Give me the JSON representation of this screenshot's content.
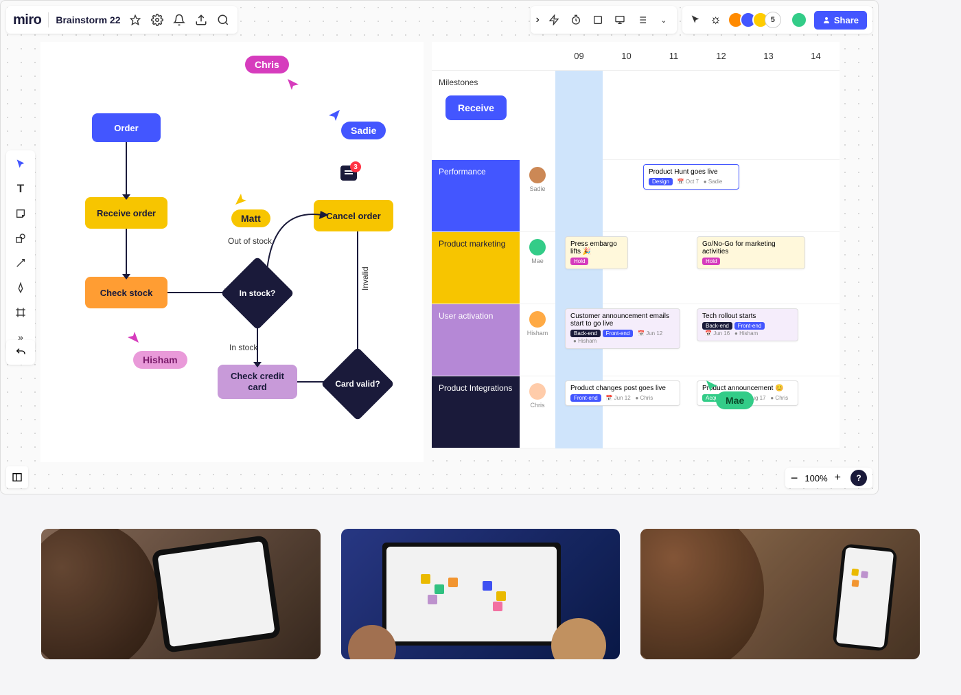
{
  "header": {
    "logo": "miro",
    "board_title": "Brainstorm 22",
    "avatar_overflow": "5",
    "share_label": "Share"
  },
  "flowchart": {
    "nodes": {
      "order": "Order",
      "receive": "Receive order",
      "check_stock": "Check stock",
      "in_stock_q": "In stock?",
      "cancel": "Cancel order",
      "check_cc": "Check credit card",
      "card_valid_q": "Card valid?"
    },
    "labels": {
      "out_of_stock": "Out of stock",
      "in_stock": "In stock",
      "invalid": "Invalid"
    },
    "cursors": {
      "chris": "Chris",
      "sadie": "Sadie",
      "matt": "Matt",
      "hisham": "Hisham",
      "mae": "Mae"
    },
    "comment_count": "3"
  },
  "timeline": {
    "cols": [
      "09",
      "10",
      "11",
      "12",
      "13",
      "14"
    ],
    "milestones_label": "Milestones",
    "receive_pill": "Receive",
    "rows": {
      "perf": {
        "label": "Performance",
        "user": "Sadie",
        "cards": [
          {
            "title": "Product Hunt goes live",
            "tag": "Design",
            "tag_color": "#4356ff",
            "date": "Oct 7",
            "owner": "Sadie"
          }
        ]
      },
      "mkt": {
        "label": "Product marketing",
        "user": "Mae",
        "cards": [
          {
            "title": "Press embargo lifts 🎉",
            "tag": "Hold",
            "tag_color": "#d63cbd"
          },
          {
            "title": "Go/No-Go for marketing activities",
            "tag": "Hold",
            "tag_color": "#d63cbd"
          }
        ]
      },
      "act": {
        "label": "User activation",
        "user": "Hisham",
        "cards": [
          {
            "title": "Customer announcement emails start to go live",
            "tag": "Back-end",
            "tag2": "Front-end",
            "tag_color": "#1a1a3a",
            "tag2_color": "#4356ff",
            "date": "Jun 12",
            "owner": "Hisham"
          },
          {
            "title": "Tech rollout starts",
            "tag": "Back-end",
            "tag2": "Front-end",
            "tag_color": "#1a1a3a",
            "tag2_color": "#4356ff",
            "date": "Jun 16",
            "owner": "Hisham"
          }
        ]
      },
      "int": {
        "label": "Product Integrations",
        "user": "Chris",
        "cards": [
          {
            "title": "Product changes post goes live",
            "tag": "Front-end",
            "tag_color": "#4356ff",
            "date": "Jun 12",
            "owner": "Chris"
          },
          {
            "title": "Product announcement 😊",
            "tag": "Acquisition",
            "tag_color": "#33cc88",
            "date": "Aug 17",
            "owner": "Chris"
          }
        ]
      }
    }
  },
  "zoom": {
    "level": "100%"
  }
}
